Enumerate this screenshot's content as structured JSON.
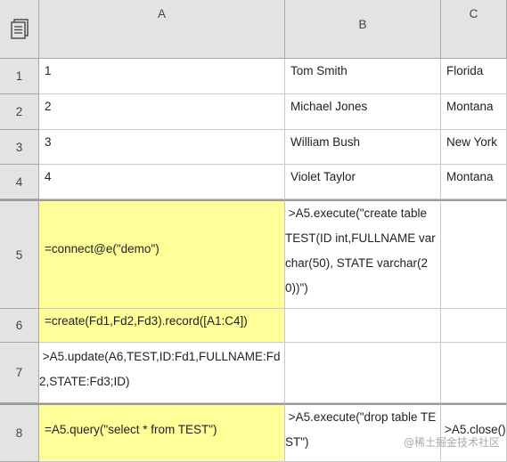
{
  "columns": [
    "A",
    "B",
    "C"
  ],
  "rows": [
    {
      "num": "1",
      "a": "1",
      "b": "Tom Smith",
      "c": "Florida"
    },
    {
      "num": "2",
      "a": "2",
      "b": "Michael Jones",
      "c": "Montana"
    },
    {
      "num": "3",
      "a": "3",
      "b": "William Bush",
      "c": "New York"
    },
    {
      "num": "4",
      "a": "4",
      "b": "Violet Taylor",
      "c": "Montana"
    },
    {
      "num": "5",
      "a": "=connect@e(\"demo\")",
      "b": " >A5.execute(\"create table TEST(ID int,FULLNAME varchar(50), STATE varchar(20))\")",
      "c": ""
    },
    {
      "num": "6",
      "a": "=create(Fd1,Fd2,Fd3).record([A1:C4])",
      "b": "",
      "c": ""
    },
    {
      "num": "7",
      "a": " >A5.update(A6,TEST,ID:Fd1,FULLNAME:Fd2,STATE:Fd3;ID)",
      "b": "",
      "c": ""
    },
    {
      "num": "8",
      "a": "=A5.query(\"select * from TEST\")",
      "b": " >A5.execute(\"drop table TEST\")",
      "c": ">A5.close()"
    }
  ],
  "watermark": "@稀土掘金技术社区",
  "colors": {
    "header_bg": "#e3e3e3",
    "highlight": "#ffff99",
    "grid": "#c9c9c9"
  }
}
